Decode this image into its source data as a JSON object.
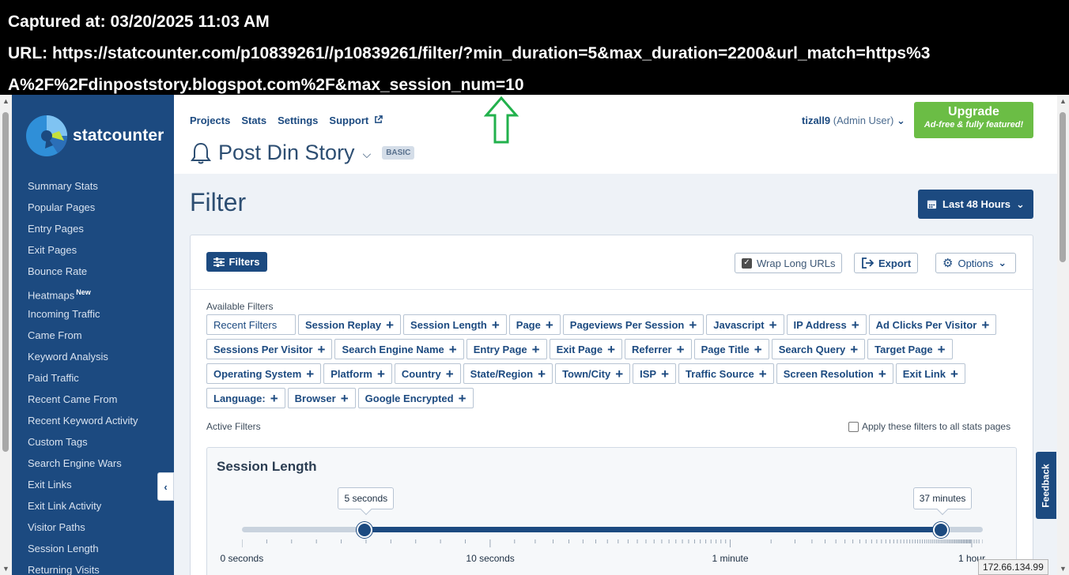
{
  "caption": {
    "line1": "Captured at: 03/20/2025 11:03 AM",
    "line2": "URL: https://statcounter.com/p10839261//p10839261/filter/?min_duration=5&max_duration=2200&url_match=https%3",
    "line3": "A%2F%2Fdinpoststory.blogspot.com%2F&max_session_num=10"
  },
  "brand": {
    "name": "statcounter"
  },
  "sidebar": {
    "items": [
      {
        "label": "Summary Stats"
      },
      {
        "label": "Popular Pages"
      },
      {
        "label": "Entry Pages"
      },
      {
        "label": "Exit Pages"
      },
      {
        "label": "Bounce Rate"
      },
      {
        "label": "Heatmaps",
        "badge": "New"
      },
      {
        "label": "Incoming Traffic"
      },
      {
        "label": "Came From"
      },
      {
        "label": "Keyword Analysis"
      },
      {
        "label": "Paid Traffic"
      },
      {
        "label": "Recent Came From"
      },
      {
        "label": "Recent Keyword Activity"
      },
      {
        "label": "Custom Tags"
      },
      {
        "label": "Search Engine Wars"
      },
      {
        "label": "Exit Links"
      },
      {
        "label": "Exit Link Activity"
      },
      {
        "label": "Visitor Paths"
      },
      {
        "label": "Session Length"
      },
      {
        "label": "Returning Visits"
      }
    ],
    "collapse_icon": "chevron-left-icon"
  },
  "topnav": {
    "projects": "Projects",
    "stats": "Stats",
    "settings": "Settings",
    "support": "Support"
  },
  "project": {
    "name": "Post Din Story",
    "plan": "BASIC"
  },
  "user": {
    "name": "tizall9",
    "role": "(Admin User)"
  },
  "upgrade": {
    "title": "Upgrade",
    "subtitle": "Ad-free & fully featured!"
  },
  "page": {
    "title": "Filter"
  },
  "date_range": {
    "label": "Last 48 Hours"
  },
  "toolbar": {
    "filters": "Filters",
    "wrap_urls": "Wrap Long URLs",
    "wrap_checked": true,
    "export": "Export",
    "options": "Options"
  },
  "available": {
    "label": "Available Filters",
    "rows": [
      [
        "Recent Filters",
        "Session Replay",
        "Session Length",
        "Page",
        "Pageviews Per Session",
        "Javascript",
        "IP Address",
        "Ad Clicks Per Visitor"
      ],
      [
        "Sessions Per Visitor",
        "Search Engine Name",
        "Entry Page",
        "Exit Page",
        "Referrer",
        "Page Title",
        "Search Query",
        "Target Page"
      ],
      [
        "Operating System",
        "Platform",
        "Country",
        "State/Region",
        "Town/City",
        "ISP",
        "Traffic Source",
        "Screen Resolution",
        "Exit Link"
      ],
      [
        "Language:",
        "Browser",
        "Google Encrypted"
      ]
    ]
  },
  "active": {
    "label": "Active Filters",
    "apply_all": "Apply these filters to all stats pages",
    "apply_all_checked": false
  },
  "session_length": {
    "title": "Session Length",
    "min_label": "5 seconds",
    "max_label": "37 minutes",
    "min_seconds": 5,
    "max_seconds": 2200,
    "scale": [
      "0 seconds",
      "10 seconds",
      "1 minute",
      "1 hour"
    ]
  },
  "feedback": {
    "label": "Feedback"
  },
  "ip": {
    "address": "172.66.134.99"
  },
  "colors": {
    "brand": "#1c4a80",
    "upgrade": "#6bbd45",
    "caption_bg": "#000000",
    "arrow": "#22b14c"
  }
}
